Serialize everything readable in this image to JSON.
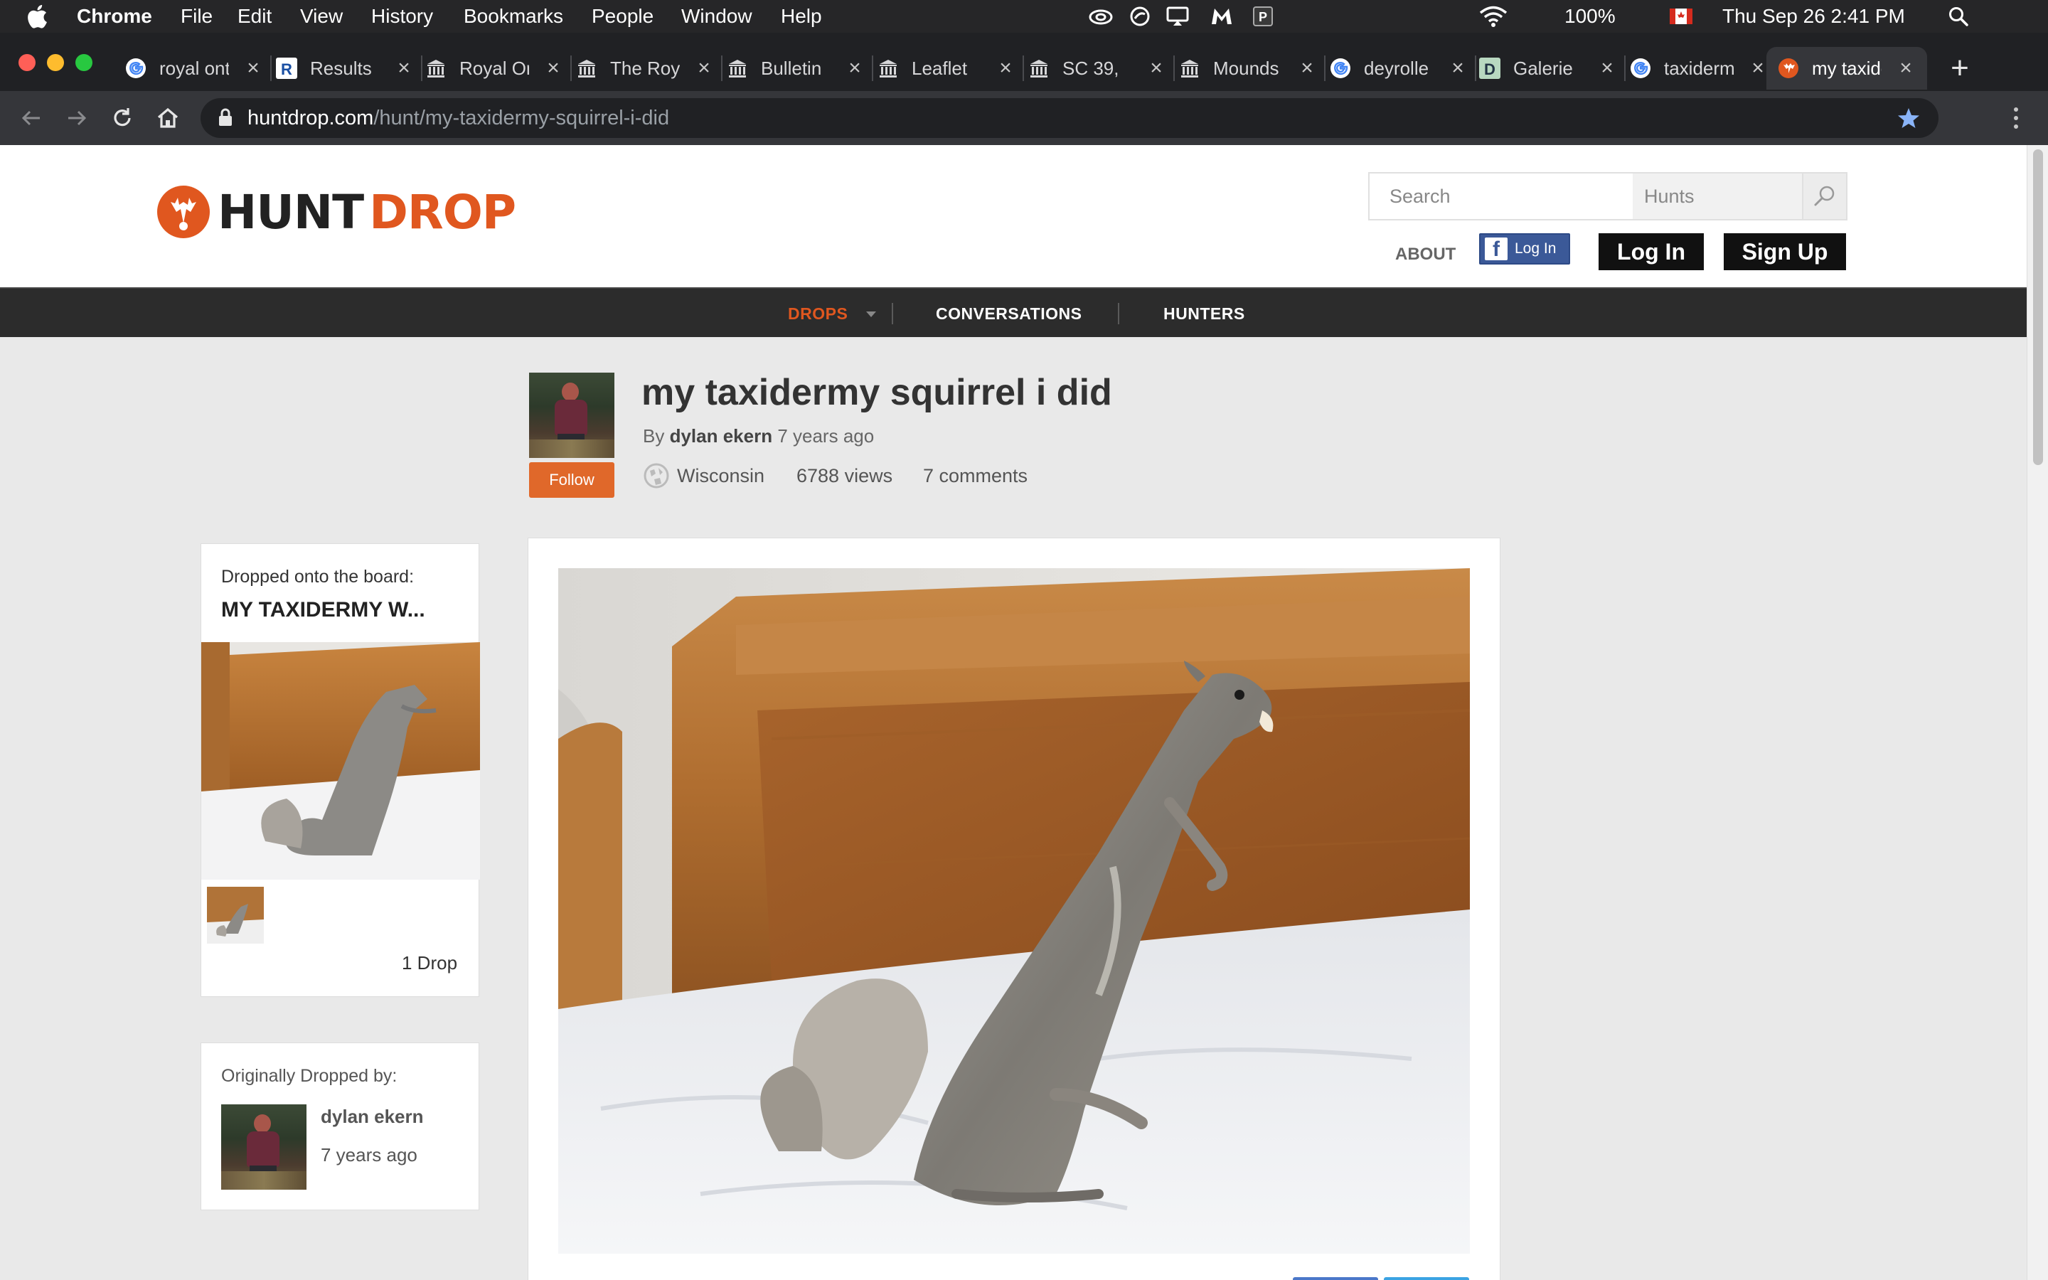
{
  "menubar": {
    "app": "Chrome",
    "items": [
      "File",
      "Edit",
      "View",
      "History",
      "Bookmarks",
      "People",
      "Window",
      "Help"
    ],
    "battery": "100%",
    "clock": "Thu Sep 26  2:41 PM"
  },
  "tabs": [
    {
      "label": "royal ontario museum",
      "icon": "google-icon"
    },
    {
      "label": "Results",
      "icon": "r-icon"
    },
    {
      "label": "Royal Ontario",
      "icon": "museum-icon"
    },
    {
      "label": "The Royal",
      "icon": "museum-icon"
    },
    {
      "label": "Bulletin",
      "icon": "museum-icon"
    },
    {
      "label": "Leaflet",
      "icon": "museum-icon"
    },
    {
      "label": "SC 39,",
      "icon": "museum-icon"
    },
    {
      "label": "Mounds",
      "icon": "museum-icon"
    },
    {
      "label": "deyrolle",
      "icon": "google-icon"
    },
    {
      "label": "Galerie",
      "icon": "d-icon"
    },
    {
      "label": "taxidermy",
      "icon": "google-icon"
    },
    {
      "label": "my taxidermy",
      "icon": "huntdrop-icon",
      "active": true
    }
  ],
  "address": {
    "host": "huntdrop.com",
    "path": "/hunt/my-taxidermy-squirrel-i-did"
  },
  "site": {
    "logo_a": "HUNT",
    "logo_b": "DROP",
    "search_placeholder": "Search",
    "search_scope": "Hunts",
    "about": "ABOUT",
    "fb_login": "Log In",
    "login": "Log In",
    "signup": "Sign Up"
  },
  "nav": {
    "drops": "DROPS",
    "conversations": "CONVERSATIONS",
    "hunters": "HUNTERS"
  },
  "post": {
    "title": "my taxidermy squirrel i did",
    "by": "By",
    "author": "dylan ekern",
    "age": "7 years ago",
    "follow": "Follow",
    "location": "Wisconsin",
    "views": "6788 views",
    "comments": "7 comments"
  },
  "board_card": {
    "label": "Dropped onto the board:",
    "board": "MY TAXIDERMY W...",
    "drops": "1 Drop"
  },
  "origin_card": {
    "label": "Originally Dropped by:",
    "author": "dylan ekern",
    "age": "7 years ago"
  },
  "colors": {
    "accent": "#e0571f",
    "nav_bg": "#2c2c2c",
    "facebook": "#3b5998"
  }
}
